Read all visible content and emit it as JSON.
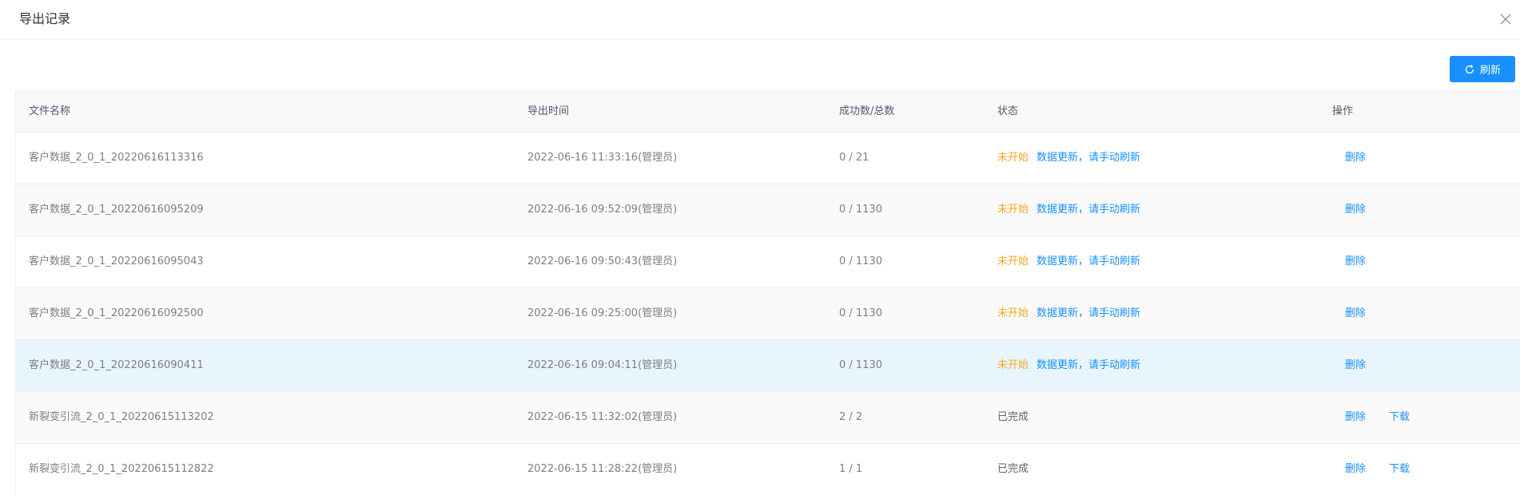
{
  "dialog": {
    "title": "导出记录",
    "refresh_label": "刷新"
  },
  "table": {
    "headers": {
      "name": "文件名称",
      "time": "导出时间",
      "count": "成功数/总数",
      "status": "状态",
      "op": "操作"
    },
    "rows": [
      {
        "name": "客户数据_2_0_1_20220616113316",
        "time": "2022-06-16 11:33:16(管理员)",
        "count": "0 / 21",
        "status": "未开始",
        "status_link": "数据更新，请手动刷新",
        "delete": "删除",
        "download": ""
      },
      {
        "name": "客户数据_2_0_1_20220616095209",
        "time": "2022-06-16 09:52:09(管理员)",
        "count": "0 / 1130",
        "status": "未开始",
        "status_link": "数据更新，请手动刷新",
        "delete": "删除",
        "download": ""
      },
      {
        "name": "客户数据_2_0_1_20220616095043",
        "time": "2022-06-16 09:50:43(管理员)",
        "count": "0 / 1130",
        "status": "未开始",
        "status_link": "数据更新，请手动刷新",
        "delete": "删除",
        "download": ""
      },
      {
        "name": "客户数据_2_0_1_20220616092500",
        "time": "2022-06-16 09:25:00(管理员)",
        "count": "0 / 1130",
        "status": "未开始",
        "status_link": "数据更新，请手动刷新",
        "delete": "删除",
        "download": ""
      },
      {
        "name": "客户数据_2_0_1_20220616090411",
        "time": "2022-06-16 09:04:11(管理员)",
        "count": "0 / 1130",
        "status": "未开始",
        "status_link": "数据更新，请手动刷新",
        "delete": "删除",
        "download": ""
      },
      {
        "name": "新裂变引流_2_0_1_20220615113202",
        "time": "2022-06-15 11:32:02(管理员)",
        "count": "2 / 2",
        "status": "已完成",
        "status_link": "",
        "delete": "删除",
        "download": "下载"
      },
      {
        "name": "新裂变引流_2_0_1_20220615112822",
        "time": "2022-06-15 11:28:22(管理员)",
        "count": "1 / 1",
        "status": "已完成",
        "status_link": "",
        "delete": "删除",
        "download": "下载"
      }
    ]
  },
  "colors": {
    "primary": "#1890ff",
    "pending": "#f5a623",
    "row_hover": "#e8f5fc"
  }
}
